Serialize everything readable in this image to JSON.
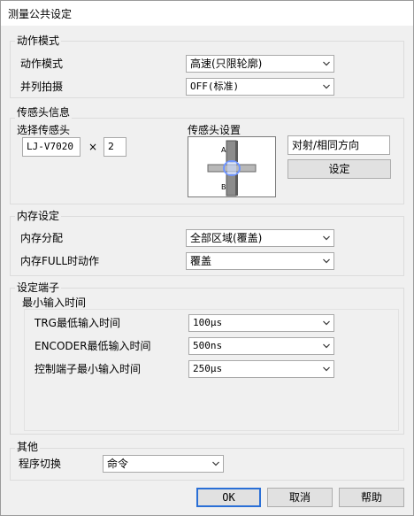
{
  "window": {
    "title": "测量公共设定"
  },
  "motion": {
    "group_label": "动作模式",
    "rows": [
      {
        "label": "动作模式",
        "value": "高速(只限轮廓)"
      },
      {
        "label": "并列拍摄",
        "value": "OFF(标准)"
      }
    ]
  },
  "sensor": {
    "group_label": "传感头信息",
    "select_label": "选择传感头",
    "model": "LJ-V7020",
    "times_symbol": "×",
    "count": "2",
    "setup_label": "传感头设置",
    "head_a": "A",
    "head_b": "B",
    "direction_value": "对射/相同方向",
    "set_button": "设定"
  },
  "memory": {
    "group_label": "内存设定",
    "rows": [
      {
        "label": "内存分配",
        "value": "全部区域(覆盖)"
      },
      {
        "label": "内存FULL时动作",
        "value": "覆盖"
      }
    ]
  },
  "terminal": {
    "group_label": "设定端子",
    "sub_label": "最小输入时间",
    "rows": [
      {
        "label": "TRG最低输入时间",
        "value": "100μs"
      },
      {
        "label": "ENCODER最低输入时间",
        "value": "500ns"
      },
      {
        "label": "控制端子最小输入时间",
        "value": "250μs"
      }
    ]
  },
  "other": {
    "group_label": "其他",
    "program_label": "程序切换",
    "program_value": "命令"
  },
  "footer": {
    "ok": "OK",
    "cancel": "取消",
    "help": "帮助"
  }
}
